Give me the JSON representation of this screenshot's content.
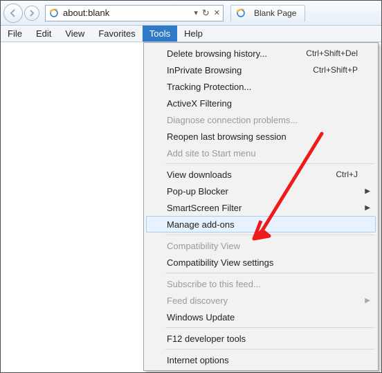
{
  "toolbar": {
    "url": "about:blank",
    "tab_title": "Blank Page"
  },
  "menubar": {
    "items": [
      "File",
      "Edit",
      "View",
      "Favorites",
      "Tools",
      "Help"
    ],
    "active_index": 4
  },
  "dropdown": [
    {
      "t": "item",
      "label": "Delete browsing history...",
      "shortcut": "Ctrl+Shift+Del"
    },
    {
      "t": "item",
      "label": "InPrivate Browsing",
      "shortcut": "Ctrl+Shift+P"
    },
    {
      "t": "item",
      "label": "Tracking Protection..."
    },
    {
      "t": "item",
      "label": "ActiveX Filtering"
    },
    {
      "t": "item",
      "label": "Diagnose connection problems...",
      "disabled": true
    },
    {
      "t": "item",
      "label": "Reopen last browsing session"
    },
    {
      "t": "item",
      "label": "Add site to Start menu",
      "disabled": true
    },
    {
      "t": "sep"
    },
    {
      "t": "item",
      "label": "View downloads",
      "shortcut": "Ctrl+J"
    },
    {
      "t": "item",
      "label": "Pop-up Blocker",
      "submenu": true
    },
    {
      "t": "item",
      "label": "SmartScreen Filter",
      "submenu": true
    },
    {
      "t": "item",
      "label": "Manage add-ons",
      "hover": true
    },
    {
      "t": "sep"
    },
    {
      "t": "item",
      "label": "Compatibility View",
      "disabled": true
    },
    {
      "t": "item",
      "label": "Compatibility View settings"
    },
    {
      "t": "sep"
    },
    {
      "t": "item",
      "label": "Subscribe to this feed...",
      "disabled": true
    },
    {
      "t": "item",
      "label": "Feed discovery",
      "submenu": true,
      "disabled": true
    },
    {
      "t": "item",
      "label": "Windows Update"
    },
    {
      "t": "sep"
    },
    {
      "t": "item",
      "label": "F12 developer tools"
    },
    {
      "t": "sep"
    },
    {
      "t": "item",
      "label": "Internet options"
    }
  ]
}
